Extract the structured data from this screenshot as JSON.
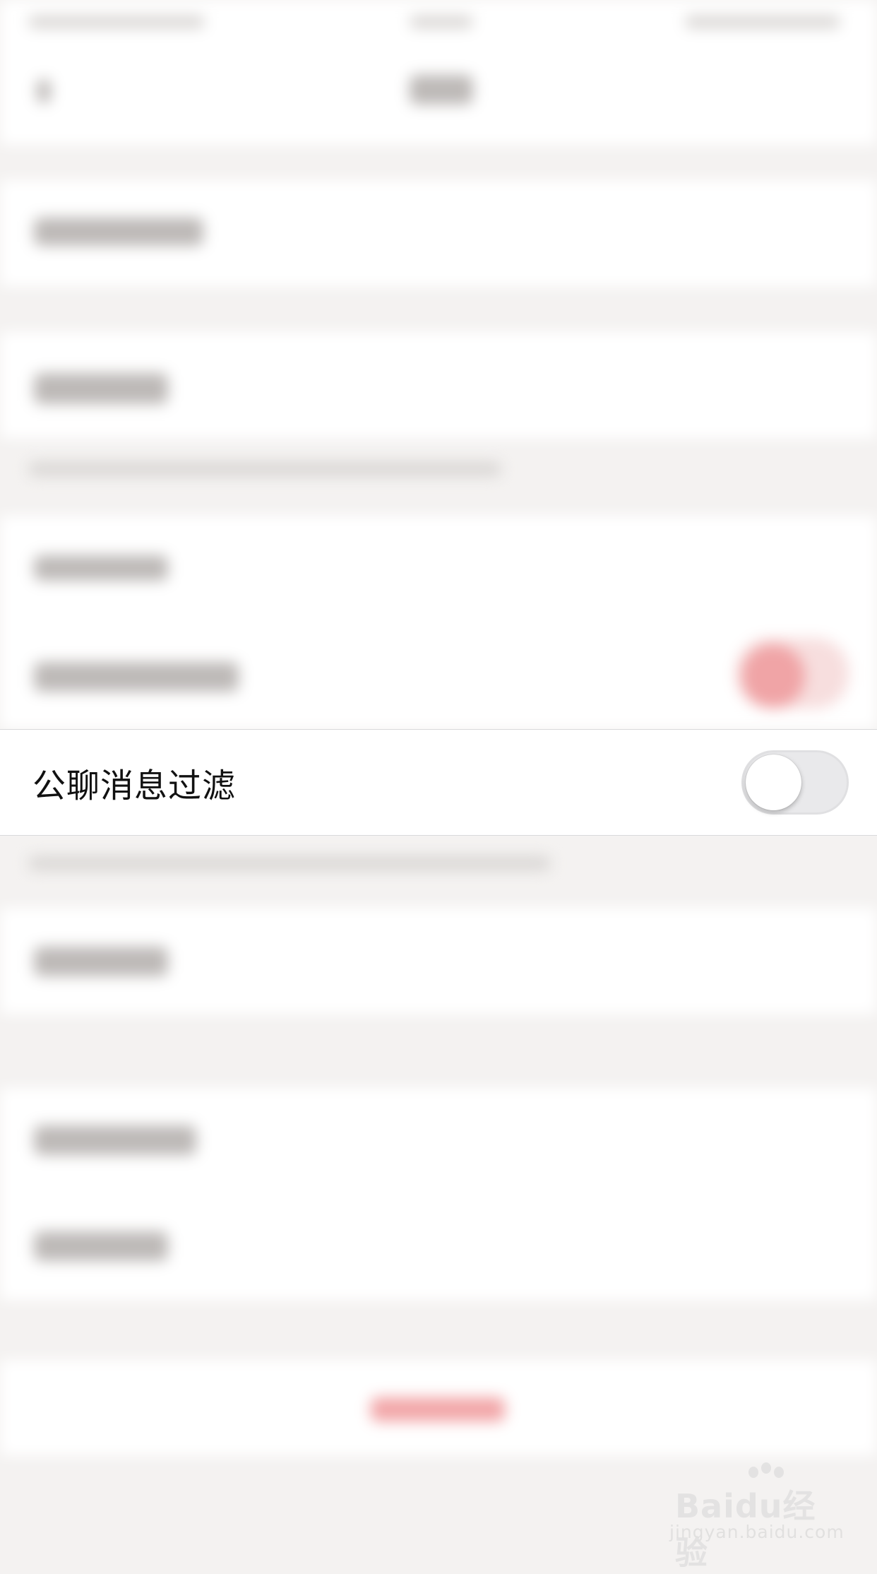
{
  "settings_row": {
    "label": "公聊消息过滤",
    "toggle_on": false
  },
  "colors": {
    "background": "#f4f2f1",
    "row_background": "#ffffff",
    "toggle_off_track": "#e9e9eb",
    "accent_blurred": "#f0a4a6"
  },
  "watermark": {
    "logo": "Baidu经验",
    "url": "jingyan.baidu.com"
  }
}
